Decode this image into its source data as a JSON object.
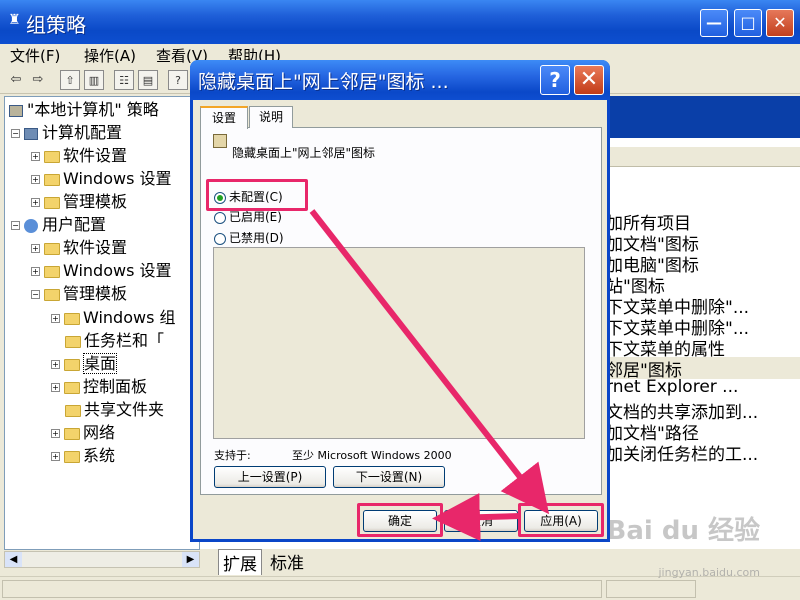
{
  "main_window": {
    "title": "组策略",
    "app_icon": "gpedit-icon",
    "controls": {
      "minimize": "—",
      "maximize": "□",
      "close": "✕"
    }
  },
  "menu": [
    "文件(F)",
    "操作(A)",
    "查看(V)",
    "帮助(H)"
  ],
  "toolbar_icons": [
    "back-arrow-icon",
    "forward-arrow-icon",
    "up-folder-icon",
    "show-hide-tree-icon",
    "properties-icon",
    "export-list-icon",
    "help-icon"
  ],
  "tree": {
    "root": "\"本地计算机\" 策略",
    "computer_config": "计算机配置",
    "cc_items": [
      "软件设置",
      "Windows 设置",
      "管理模板"
    ],
    "user_config": "用户配置",
    "uc_items": [
      "软件设置",
      "Windows 设置",
      "管理模板"
    ],
    "admin_templates_children": [
      "Windows 组",
      "任务栏和「",
      "桌面",
      "控制面板",
      "共享文件夹",
      "网络",
      "系统"
    ],
    "selected": "桌面"
  },
  "right_list": [
    "删除桌面上的所有项目",
    "删除桌面上的\"我的文档\"图标",
    "隐藏桌面上的\"我的电脑\"图标",
    "隐藏桌面上的\"回收站\"图标",
    "从\"我的文档\"的上下文菜单中删除\"...",
    "从\"我的电脑\"的上下文菜单中删除\"...",
    "从\"回收站\"的上下文菜单中删除\"属性",
    "隐藏桌面上的\"网上邻居\"图标",
    "隐藏桌面上的Internet Explorer ...",
    "不要将已打开文档的共享添加到...",
    "禁止用户更改\"我的文档\"路径",
    "退出时不保存设置，和关闭任务栏的工..."
  ],
  "right_list_visible": [
    "加所有项目",
    "加文档\"图标",
    "加电脑\"图标",
    "站\"图标",
    "下文菜单中删除\"...",
    "下文菜单中删除\"...",
    "下文菜单的属性",
    "邻居\"图标",
    "rnet Explorer ...",
    "文档的共享添加到...",
    "加文档\"路径",
    "加关闭任务栏的工..."
  ],
  "bottom_tabs": [
    "扩展",
    "标准"
  ],
  "dialog": {
    "title": "隐藏桌面上\"网上邻居\"图标 ...",
    "help_btn": "?",
    "close_btn": "✕",
    "tabs": [
      "设置",
      "说明"
    ],
    "policy_name": "隐藏桌面上\"网上邻居\"图标",
    "options": [
      {
        "label": "未配置(C)",
        "checked": true
      },
      {
        "label": "已启用(E)",
        "checked": false
      },
      {
        "label": "已禁用(D)",
        "checked": false
      }
    ],
    "supported_label": "支持于:",
    "supported_value": "至少 Microsoft Windows 2000",
    "prev_btn": "上一设置(P)",
    "next_btn": "下一设置(N)",
    "ok_btn": "确定",
    "cancel_btn": "取消",
    "apply_btn": "应用(A)"
  },
  "watermark": {
    "brand": "Bai du 经验",
    "url": "jingyan.baidu.com"
  },
  "annotation_color": "#e8276a"
}
